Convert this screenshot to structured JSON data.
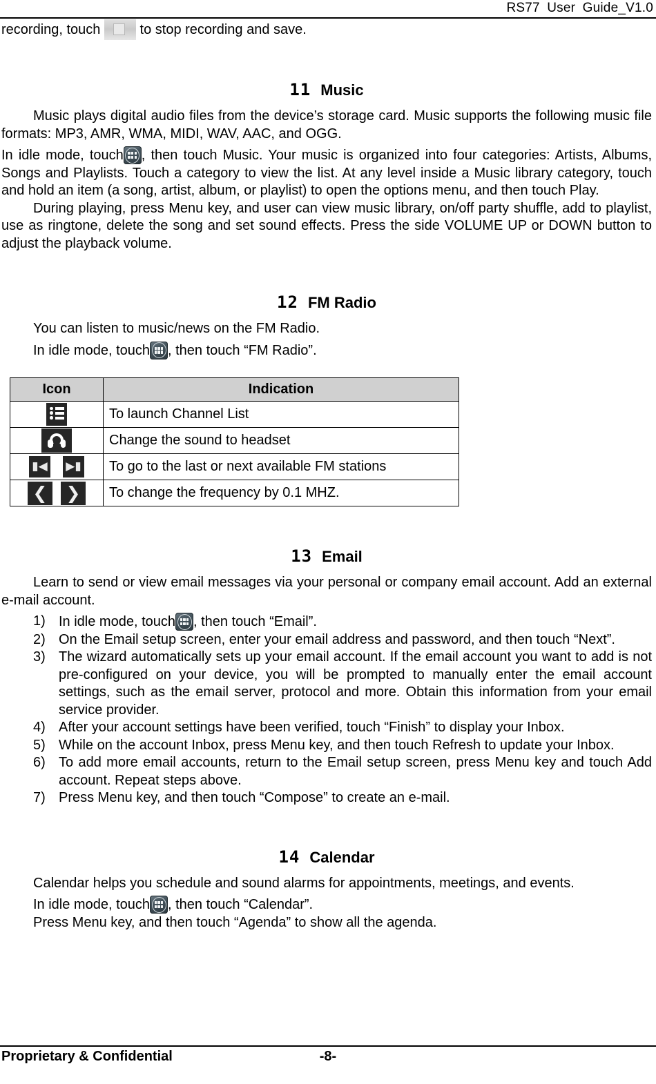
{
  "header": {
    "title": "RS77  User  Guide_V1.0"
  },
  "continued_paragraph": {
    "before_icon": "recording, touch ",
    "icon": "stop-recording-button",
    "after_icon": " to stop recording and save."
  },
  "sections": [
    {
      "number": "11",
      "name": "Music",
      "paragraphs": [
        "Music plays digital audio files from the device’s storage card. Music supports the following music file formats: MP3, AMR, WMA, MIDI, WAV, AAC, and OGG.",
        "In idle mode, touch",
        ", then touch Music. Your music is organized into four categories: Artists, Albums, Songs and Playlists. Touch a category to view the list. At any level inside a Music library category, touch and hold an item (a song, artist, album, or playlist) to open the options menu, and then touch Play.",
        "During playing, press Menu key, and user can view music library, on/off party shuffle, add to playlist, use as ringtone, delete the song and set sound effects. Press the side VOLUME UP or DOWN button to adjust the playback volume."
      ]
    },
    {
      "number": "12",
      "name": "FM Radio",
      "paragraphs": [
        "You can listen to music/news on the FM Radio.",
        "In idle mode, touch",
        ", then touch “FM Radio”."
      ],
      "table": {
        "columns": [
          "Icon",
          "Indication"
        ],
        "rows": [
          {
            "icon": "channel-list-icon",
            "indication": "To launch Channel List"
          },
          {
            "icon": "headset-icon",
            "indication": "Change the sound to headset"
          },
          {
            "icon": "skip-previous-next-icons",
            "indication": "To go to the last or next available FM stations"
          },
          {
            "icon": "chevron-left-right-icons",
            "indication": "To change the frequency by 0.1 MHZ."
          }
        ]
      }
    },
    {
      "number": "13",
      "name": "Email",
      "paragraphs": [
        "Learn to send or view email messages via your personal or company email account. Add an external e-mail account."
      ],
      "steps": [
        {
          "before_icon": "In idle mode, touch",
          "icon": "launcher-icon",
          "after_icon": ", then touch “Email”."
        },
        {
          "text": "On the Email setup screen, enter your email address and password, and then touch “Next”."
        },
        {
          "text": "The wizard automatically sets up your email account. If the email account you want to add is not pre-configured on your device, you will be prompted to manually enter the email account settings, such as the email server, protocol and more. Obtain this information from your email service provider."
        },
        {
          "text": "After your account settings have been verified, touch “Finish” to display your Inbox."
        },
        {
          "text": "While on the account Inbox, press Menu key, and then touch Refresh to update your Inbox."
        },
        {
          "text": "To add more email accounts, return to the Email setup screen, press Menu key and touch Add account. Repeat steps above."
        },
        {
          "text": "Press Menu key, and then touch “Compose” to create an e-mail."
        }
      ]
    },
    {
      "number": "14",
      "name": "Calendar",
      "paragraphs": [
        "Calendar helps you schedule and sound alarms for appointments, meetings, and events.",
        "In idle mode, touch",
        ", then touch “Calendar”.",
        "Press Menu key, and then touch “Agenda” to show all the agenda."
      ]
    }
  ],
  "footer": {
    "left": "Proprietary & Confidential",
    "page": "-8-"
  }
}
